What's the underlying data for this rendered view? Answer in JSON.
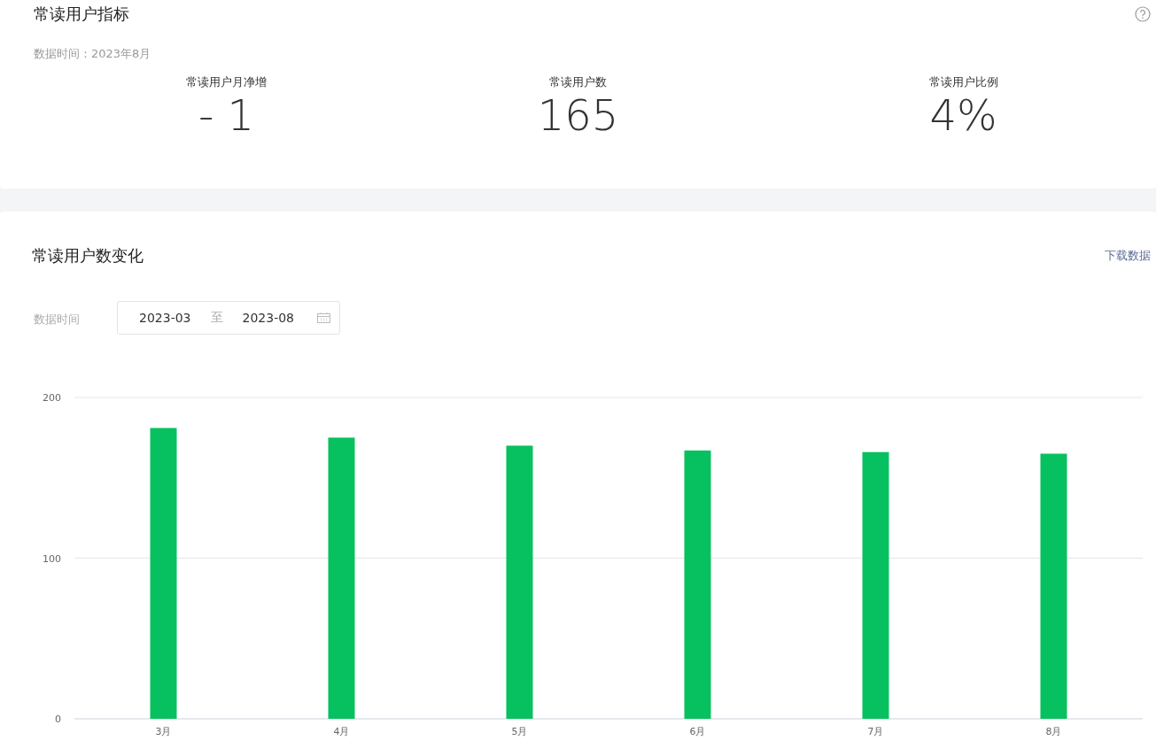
{
  "overview": {
    "title": "常读用户指标",
    "data_time": "数据时间：2023年8月",
    "metrics": [
      {
        "label": "常读用户月净增",
        "value": "- 1"
      },
      {
        "label": "常读用户数",
        "value": "165"
      },
      {
        "label": "常读用户比例",
        "value": "4%"
      }
    ]
  },
  "trend": {
    "title": "常读用户数变化",
    "download": "下载数据",
    "range_label": "数据时间",
    "range": {
      "start": "2023-03",
      "separator": "至",
      "end": "2023-08"
    },
    "chart_data": {
      "type": "bar",
      "categories": [
        "3月",
        "4月",
        "5月",
        "6月",
        "7月",
        "8月"
      ],
      "series": [
        {
          "color": "#07c160",
          "values": [
            181,
            175,
            170,
            167,
            166,
            165
          ]
        }
      ],
      "ylim": [
        0,
        200
      ],
      "yticks": [
        0,
        100,
        200
      ]
    }
  }
}
